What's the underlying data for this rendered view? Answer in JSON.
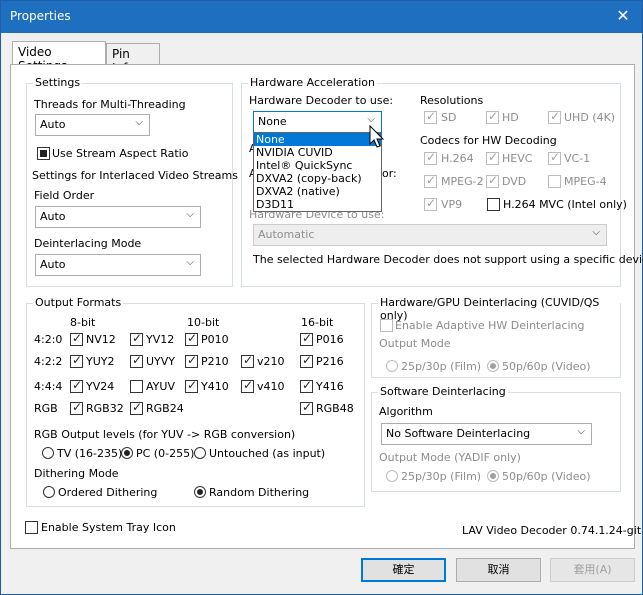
{
  "window": {
    "title": "Properties",
    "close_glyph": "✕"
  },
  "tabs": [
    {
      "label": "Video Settings"
    },
    {
      "label": "Pin Info"
    }
  ],
  "settings": {
    "group_title": "Settings",
    "threads_label": "Threads for Multi-Threading",
    "threads_value": "Auto",
    "aspect_label": "Use Stream Aspect Ratio",
    "interlaced_label": "Settings for Interlaced Video Streams",
    "field_order_label": "Field Order",
    "field_order_value": "Auto",
    "deint_mode_label": "Deinterlacing Mode",
    "deint_mode_value": "Auto"
  },
  "hw": {
    "group_title": "Hardware Acceleration",
    "decoder_label": "Hardware Decoder to use:",
    "decoder_value": "None",
    "decoder_options": [
      "None",
      "NVIDIA CUVID",
      "Intel® QuickSync",
      "DXVA2 (copy-back)",
      "DXVA2 (native)",
      "D3D11"
    ],
    "partial_a1": "A",
    "partial_a2": "A",
    "partial_or": "or:",
    "device_label": "Hardware Device to use:",
    "device_value": "Automatic",
    "device_note": "The selected Hardware Decoder does not support using a specific device.",
    "resolutions_title": "Resolutions",
    "resolutions": [
      "SD",
      "HD",
      "UHD (4K)"
    ],
    "codecs_title": "Codecs for HW Decoding",
    "codecs_row1": [
      "H.264",
      "HEVC",
      "VC-1"
    ],
    "codecs_row2": [
      "MPEG-2",
      "DVD",
      "MPEG-4"
    ],
    "codecs_row3": [
      "VP9",
      "H.264 MVC (Intel only)"
    ]
  },
  "output": {
    "group_title": "Output Formats",
    "headers": [
      "8-bit",
      "10-bit",
      "16-bit"
    ],
    "row_labels": [
      "4:2:0",
      "4:2:2",
      "4:4:4",
      "RGB"
    ],
    "row420": [
      "NV12",
      "YV12",
      "P010",
      "P016"
    ],
    "row422": [
      "YUY2",
      "UYVY",
      "P210",
      "v210",
      "P216"
    ],
    "row444": [
      "YV24",
      "AYUV",
      "Y410",
      "v410",
      "Y416"
    ],
    "rowrgb": [
      "RGB32",
      "RGB24",
      "RGB48"
    ],
    "levels_title": "RGB Output levels (for YUV -> RGB conversion)",
    "levels": [
      "TV (16-235)",
      "PC (0-255)",
      "Untouched (as input)"
    ],
    "dither_title": "Dithering Mode",
    "dither": [
      "Ordered Dithering",
      "Random Dithering"
    ]
  },
  "hwdeint": {
    "group_title": "Hardware/GPU Deinterlacing (CUVID/QS only)",
    "adaptive_label": "Enable Adaptive HW Deinterlacing",
    "mode_label": "Output Mode",
    "modes": [
      "25p/30p (Film)",
      "50p/60p (Video)"
    ]
  },
  "swdeint": {
    "group_title": "Software Deinterlacing",
    "algo_label": "Algorithm",
    "algo_value": "No Software Deinterlacing",
    "mode_label": "Output Mode (YADIF only)",
    "modes": [
      "25p/30p (Film)",
      "50p/60p (Video)"
    ]
  },
  "footer": {
    "tray_label": "Enable System Tray Icon",
    "version": "LAV Video Decoder 0.74.1.24-git",
    "ok": "確定",
    "cancel": "取消",
    "apply": "套用(A)"
  }
}
